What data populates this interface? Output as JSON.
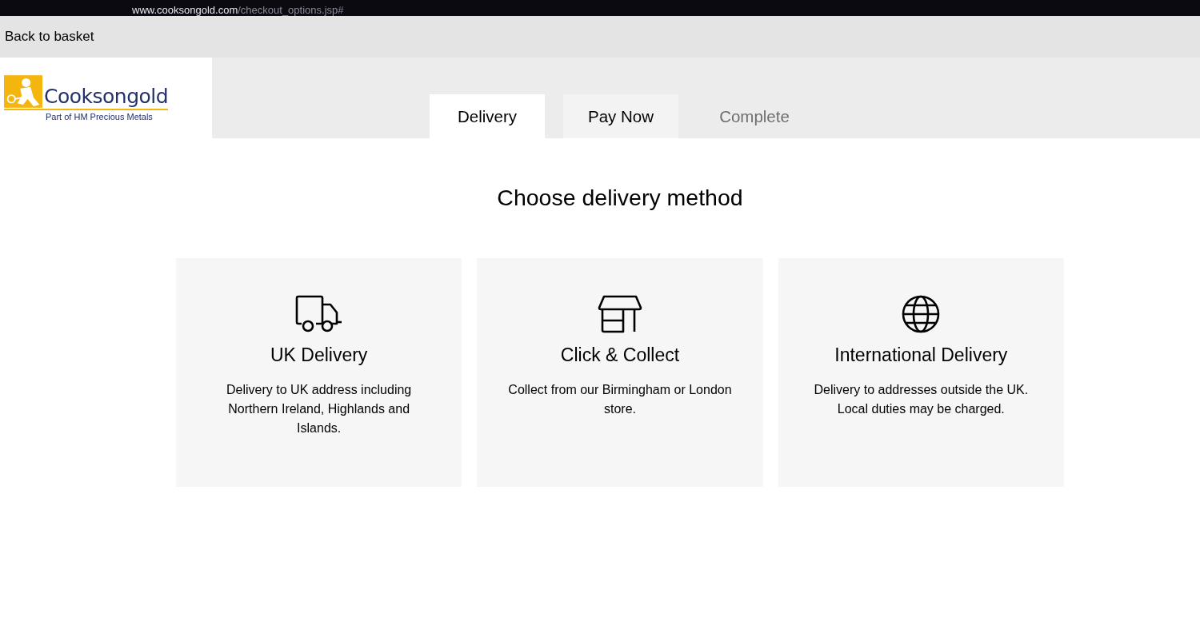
{
  "browser": {
    "url_domain": "www.cooksongold.com",
    "url_path": "/checkout_options.jsp#"
  },
  "back_link": "Back to basket",
  "logo": {
    "name": "Cooksongold",
    "tagline": "Part of HM Precious Metals"
  },
  "tabs": [
    {
      "label": "Delivery",
      "selected": true,
      "disabled": false
    },
    {
      "label": "Pay Now",
      "selected": false,
      "disabled": false
    },
    {
      "label": "Complete",
      "selected": false,
      "disabled": true
    }
  ],
  "heading": "Choose delivery method",
  "options": [
    {
      "kind": "truck",
      "title": "UK Delivery",
      "description": "Delivery to UK address including Northern Ireland, Highlands and Islands."
    },
    {
      "kind": "store",
      "title": "Click & Collect",
      "description": "Collect from our Birmingham or London store."
    },
    {
      "kind": "globe",
      "title": "International Delivery",
      "description": "Delivery to addresses outside the UK. Local duties may be charged."
    }
  ]
}
